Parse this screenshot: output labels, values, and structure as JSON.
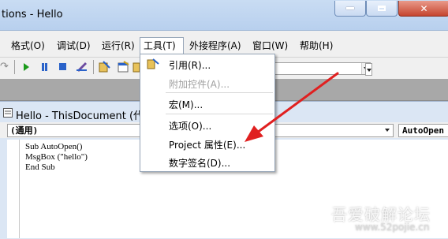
{
  "window": {
    "title": "tions - Hello"
  },
  "menubar": {
    "items": [
      {
        "label": "格式(O)"
      },
      {
        "label": "调试(D)"
      },
      {
        "label": "运行(R)"
      },
      {
        "label": "工具(T)"
      },
      {
        "label": "外接程序(A)"
      },
      {
        "label": "窗口(W)"
      },
      {
        "label": "帮助(H)"
      }
    ]
  },
  "tools_menu": {
    "items": [
      {
        "label": "引用(R)...",
        "enabled": true
      },
      {
        "label": "附加控件(A)...",
        "enabled": false
      },
      {
        "label": "宏(M)...",
        "enabled": true
      },
      {
        "label": "选项(O)...",
        "enabled": true
      },
      {
        "label": "Project 属性(E)...",
        "enabled": true
      },
      {
        "label": "数字签名(D)...",
        "enabled": true
      }
    ]
  },
  "code_window": {
    "title": "Hello - ThisDocument (代码",
    "object_combo": "(通用)",
    "procedure_combo": "AutoOpen",
    "lines": [
      "Sub AutoOpen()",
      "MsgBox (\"hello\")",
      "End Sub"
    ]
  },
  "watermark": {
    "text": "吾爱破解论坛",
    "url": "www.52pojie.cn"
  },
  "colors": {
    "annotation_arrow": "#e02020",
    "titlebar": "#c9dcf3"
  }
}
